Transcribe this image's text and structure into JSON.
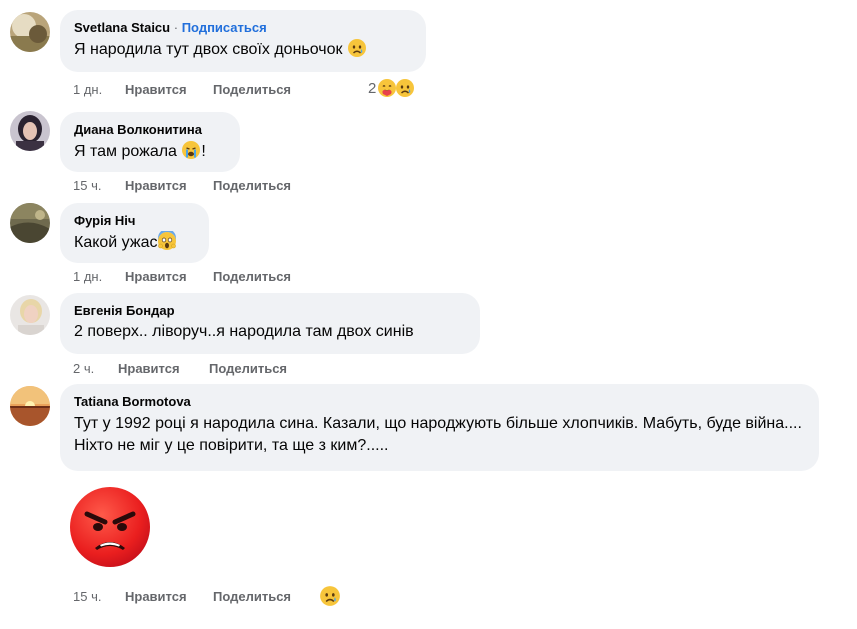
{
  "comments": [
    {
      "author": "Svetlana Staicu",
      "follow_separator": "·",
      "follow_label": "Подписаться",
      "text": "Я народила тут двох своїх доньочок",
      "text_emoji": "sad-tear-emoji",
      "time": "1 дн.",
      "like_label": "Нравится",
      "reply_label": "Поделиться",
      "reaction_count": "2",
      "reaction_icons": [
        "hug-emoji",
        "sad-tear-emoji"
      ]
    },
    {
      "author": "Диана Волконитина",
      "text_before": "Я там рожала ",
      "text_emoji": "crying-emoji",
      "text_after": "!",
      "time": "15 ч.",
      "like_label": "Нравится",
      "reply_label": "Поделиться"
    },
    {
      "author": "Фурія Ніч",
      "text": "Какой ужас",
      "text_emoji": "screaming-fear-emoji",
      "time": "1 дн.",
      "like_label": "Нравится",
      "reply_label": "Поделиться"
    },
    {
      "author": "Евгенія Бондар",
      "text": "2 поверх.. ліворуч..я народила там двох синів",
      "time": "2 ч.",
      "like_label": "Нравится",
      "reply_label": "Поделиться"
    },
    {
      "author": "Tatiana Bormotova",
      "text": "Тут у 1992 році я народила сина. Казали, що народжують більше хлопчиків. Мабуть, буде війна.... Ніхто не міг у це повірити, та ще з ким?.....",
      "sticker": "angry-face-sticker",
      "time": "15 ч.",
      "like_label": "Нравится",
      "reply_label": "Поделиться",
      "reaction_icons": [
        "sad-tear-emoji"
      ]
    }
  ],
  "colors": {
    "bubble_bg": "#f0f2f5",
    "meta_text": "#65676b",
    "follow_link": "#216fdb",
    "primary_text": "#050505"
  }
}
